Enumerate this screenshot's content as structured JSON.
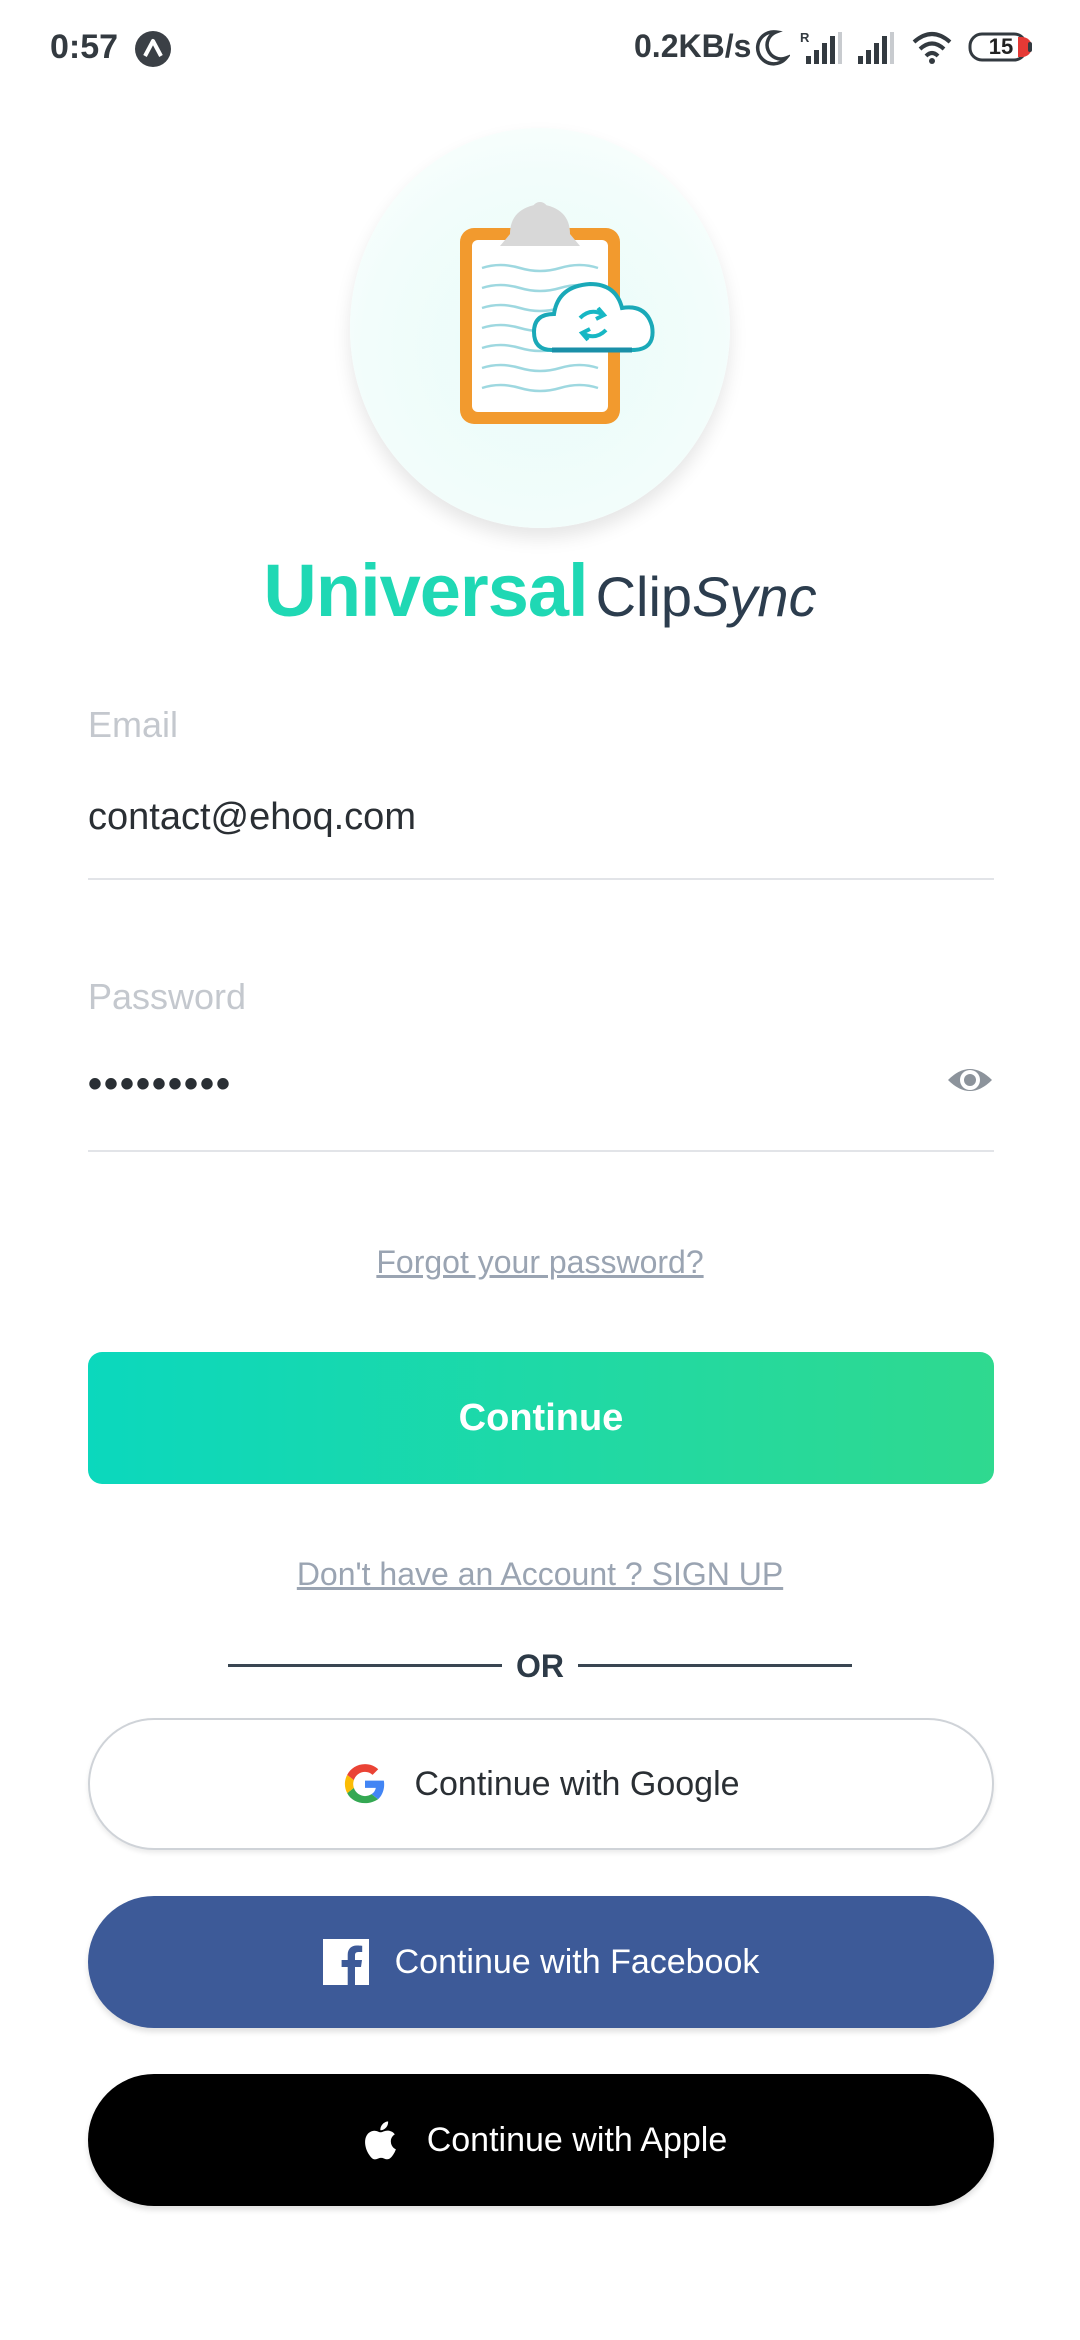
{
  "status_bar": {
    "time": "0:57",
    "network_speed": "0.2KB/s",
    "battery_level": "15",
    "icons": [
      "app-notification-icon",
      "moon-icon",
      "signal-icon",
      "signal-icon",
      "wifi-icon",
      "battery-icon"
    ]
  },
  "brand": {
    "word1": "Universal",
    "word2": "Clip",
    "word3": "Sync",
    "accent_color": "#1fd8b4",
    "dark_color": "#2c3d4e"
  },
  "form": {
    "email_label": "Email",
    "email_value": "contact@ehoq.com",
    "password_label": "Password",
    "password_value": "•••••••••",
    "forgot_link": "Forgot your password?",
    "continue_label": "Continue",
    "signup_link": "Don't have an Account ? SIGN UP",
    "or_text": "OR"
  },
  "social": {
    "google_label": "Continue with Google",
    "facebook_label": "Continue with Facebook",
    "apple_label": "Continue with Apple",
    "facebook_color": "#3d5a98",
    "apple_color": "#000000"
  }
}
